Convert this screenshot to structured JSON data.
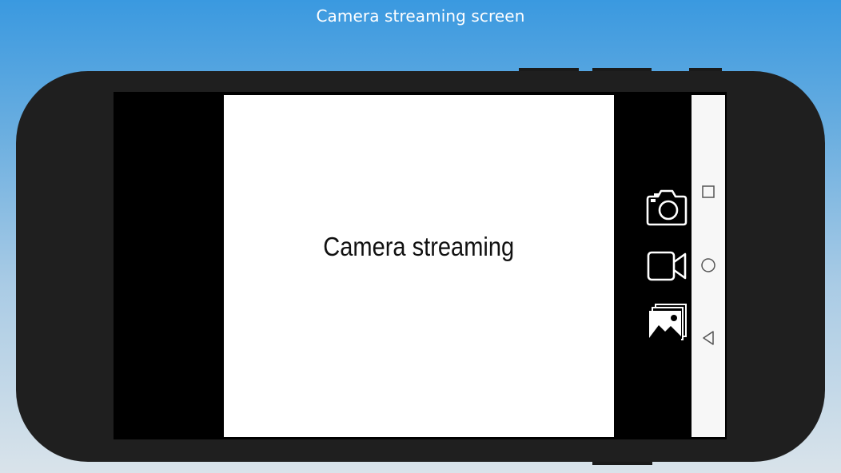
{
  "page": {
    "caption": "Camera streaming screen"
  },
  "viewfinder": {
    "label": "Camera streaming"
  },
  "controls": {
    "items": [
      {
        "name": "take-photo-button",
        "icon": "camera-icon"
      },
      {
        "name": "record-video-button",
        "icon": "video-camera-icon"
      },
      {
        "name": "gallery-button",
        "icon": "gallery-icon"
      }
    ]
  },
  "navbar": {
    "items": [
      {
        "name": "nav-recents-button",
        "icon": "square-icon"
      },
      {
        "name": "nav-home-button",
        "icon": "circle-icon"
      },
      {
        "name": "nav-back-button",
        "icon": "triangle-back-icon"
      }
    ]
  },
  "colors": {
    "background_top": "#3a99e0",
    "background_bottom": "#d9e3ea",
    "device_body": "#1f1f1f",
    "screen": "#000000",
    "viewfinder": "#ffffff",
    "navbar": "#f7f7f7"
  }
}
